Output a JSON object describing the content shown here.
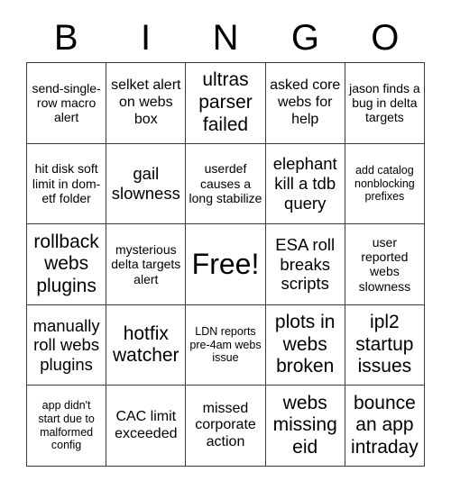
{
  "card": {
    "title_letters": [
      "B",
      "I",
      "N",
      "G",
      "O"
    ],
    "columns": [
      "B",
      "I",
      "N",
      "G",
      "O"
    ],
    "free_space_label": "Free!",
    "free_space_position": {
      "row": 3,
      "column": 3
    },
    "grid_size": "5x5",
    "colors": {
      "background": "#ffffff",
      "text": "#000000",
      "grid_line": "#3a3a3a"
    },
    "rows": [
      [
        {
          "text": "send-single-row macro alert",
          "size": "s"
        },
        {
          "text": "selket alert on webs box",
          "size": "m"
        },
        {
          "text": "ultras parser failed",
          "size": "xl"
        },
        {
          "text": "asked core webs for help",
          "size": "m"
        },
        {
          "text": "jason finds a bug in delta targets",
          "size": "s"
        }
      ],
      [
        {
          "text": "hit disk soft limit in dom-etf folder",
          "size": "s"
        },
        {
          "text": "gail slowness",
          "size": "l"
        },
        {
          "text": "userdef causes a long stabilize",
          "size": "s"
        },
        {
          "text": "elephant kill a tdb query",
          "size": "l"
        },
        {
          "text": "add catalog nonblocking prefixes",
          "size": "xs"
        }
      ],
      [
        {
          "text": "rollback webs plugins",
          "size": "xl"
        },
        {
          "text": "mysterious delta targets alert",
          "size": "s"
        },
        {
          "text": "Free!",
          "size": "free"
        },
        {
          "text": "ESA roll breaks scripts",
          "size": "l"
        },
        {
          "text": "user reported webs slowness",
          "size": "s"
        }
      ],
      [
        {
          "text": "manually roll webs plugins",
          "size": "l"
        },
        {
          "text": "hotfix watcher",
          "size": "xl"
        },
        {
          "text": "LDN reports pre-4am webs issue",
          "size": "xs"
        },
        {
          "text": "plots in webs broken",
          "size": "xl"
        },
        {
          "text": "ipl2 startup issues",
          "size": "xl"
        }
      ],
      [
        {
          "text": "app didn't start due to malformed config",
          "size": "xs"
        },
        {
          "text": "CAC limit exceeded",
          "size": "m"
        },
        {
          "text": "missed corporate action",
          "size": "m"
        },
        {
          "text": "webs missing eid",
          "size": "xl"
        },
        {
          "text": "bounce an app intraday",
          "size": "xl"
        }
      ]
    ]
  }
}
